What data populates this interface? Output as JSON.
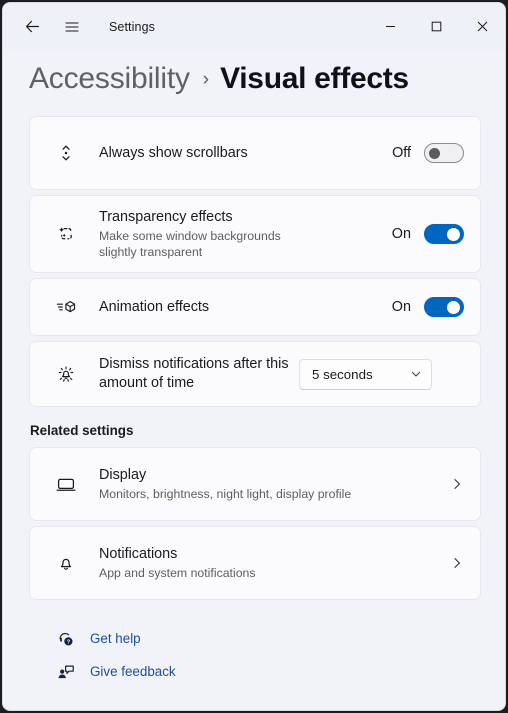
{
  "titlebar": {
    "back_label": "back-arrow",
    "menu_label": "hamburger-menu",
    "app_title": "Settings",
    "minimize": "minimize",
    "maximize": "maximize",
    "close": "close"
  },
  "breadcrumb": {
    "parent": "Accessibility",
    "separator": "›",
    "current": "Visual effects"
  },
  "settings": [
    {
      "icon": "scrollbar-icon",
      "title": "Always show scrollbars",
      "subtitle": "",
      "control": "toggle",
      "state_label": "Off",
      "state": "off"
    },
    {
      "icon": "transparency-icon",
      "title": "Transparency effects",
      "subtitle": "Make some window backgrounds slightly transparent",
      "control": "toggle",
      "state_label": "On",
      "state": "on"
    },
    {
      "icon": "animation-icon",
      "title": "Animation effects",
      "subtitle": "",
      "control": "toggle",
      "state_label": "On",
      "state": "on"
    },
    {
      "icon": "bell-alert-icon",
      "title": "Dismiss notifications after this amount of time",
      "subtitle": "",
      "control": "dropdown",
      "selected": "5 seconds"
    }
  ],
  "related": {
    "heading": "Related settings",
    "items": [
      {
        "icon": "monitor-icon",
        "title": "Display",
        "subtitle": "Monitors, brightness, night light, display profile"
      },
      {
        "icon": "bell-icon",
        "title": "Notifications",
        "subtitle": "App and system notifications"
      }
    ]
  },
  "footer_links": [
    {
      "icon": "help-icon",
      "label": "Get help"
    },
    {
      "icon": "feedback-icon",
      "label": "Give feedback"
    }
  ],
  "colors": {
    "accent": "#0067C0",
    "link": "#1b4fa0",
    "page_bg": "#F2F3F9",
    "card_bg": "#FBFBFD"
  }
}
